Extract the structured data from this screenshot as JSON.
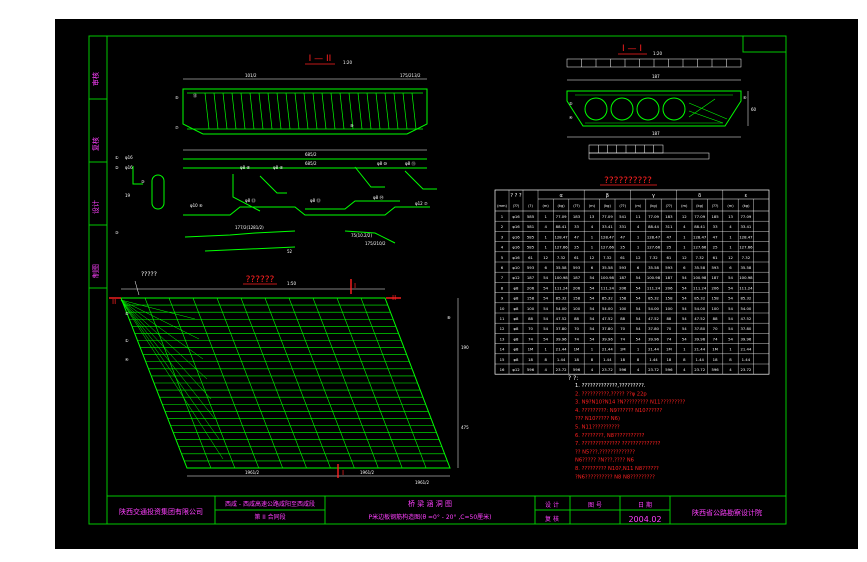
{
  "colors": {
    "background": "#000000",
    "frame": "#00c800",
    "rebar": "#00ff00",
    "dimension": "#ffffff",
    "title_red": "#ff2020",
    "table_line": "#ffffff",
    "table_text": "#ffffff",
    "note_yellow": "#ffff00",
    "label_cyan": "#00ffff",
    "label_magenta": "#ff40ff"
  },
  "side_tabs": [
    "审核",
    "复核",
    "设计",
    "制图"
  ],
  "views": {
    "section_top_title": "I — II",
    "section_top_scale": "1:20",
    "section_right_title": "I — I",
    "section_right_scale": "1:20",
    "table_title": "??????????",
    "plan_title": "??????",
    "plan_note": "?????",
    "plan_scale": "1:50",
    "cut_left": "II",
    "cut_right": "II",
    "cut_bottom": "I",
    "cut_top": "I"
  },
  "table": {
    "groups": [
      "? ? ?",
      "α",
      "β",
      "γ",
      "δ",
      "ε"
    ],
    "header_row2": [
      "(mm)",
      "(??)",
      "(?)",
      "(m)",
      "(kg)",
      "(??)",
      "(m)",
      "(kg)",
      "(??)",
      "(m)",
      "(kg)",
      "(??)",
      "(m)",
      "(kg)",
      "(??)",
      "(m)",
      "(kg)"
    ],
    "rows": [
      [
        "1",
        "φ16",
        "585",
        "1",
        "77.09",
        "183",
        "13",
        "77.09",
        "541",
        "11",
        "77.09",
        "183",
        "12",
        "77.09",
        "185",
        "13",
        "77.09"
      ],
      [
        "2",
        "φ16",
        "581",
        "4",
        "88.41",
        "33",
        "4",
        "33.41",
        "331",
        "4",
        "88.44",
        "311",
        "4",
        "88.41",
        "33",
        "4",
        "33.41"
      ],
      [
        "3",
        "φ16",
        "585",
        "1",
        "128.47",
        "47",
        "1",
        "128.47",
        "47",
        "1",
        "128.47",
        "47",
        "1",
        "128.47",
        "47",
        "1",
        "128.47"
      ],
      [
        "4",
        "φ16",
        "585",
        "1",
        "127.66",
        "25",
        "1",
        "127.66",
        "25",
        "1",
        "127.66",
        "25",
        "1",
        "127.66",
        "25",
        "1",
        "127.66"
      ],
      [
        "5",
        "φ16",
        "61",
        "12",
        "7.32",
        "61",
        "12",
        "7.32",
        "61",
        "12",
        "7.32",
        "61",
        "12",
        "7.32",
        "61",
        "12",
        "7.32"
      ],
      [
        "6",
        "φ10",
        "593",
        "6",
        "35.58",
        "593",
        "6",
        "35.58",
        "593",
        "6",
        "35.58",
        "593",
        "6",
        "35.58",
        "593",
        "6",
        "35.58"
      ],
      [
        "7",
        "φ12",
        "187",
        "54",
        "100.98",
        "187",
        "54",
        "100.98",
        "187",
        "54",
        "100.98",
        "187",
        "54",
        "100.98",
        "187",
        "54",
        "100.98"
      ],
      [
        "8",
        "φ8",
        "206",
        "54",
        "111.24",
        "206",
        "54",
        "111.24",
        "206",
        "54",
        "111.24",
        "206",
        "54",
        "111.24",
        "206",
        "54",
        "111.24"
      ],
      [
        "9",
        "φ8",
        "158",
        "54",
        "85.32",
        "158",
        "54",
        "85.32",
        "158",
        "54",
        "85.32",
        "158",
        "54",
        "85.32",
        "158",
        "54",
        "85.32"
      ],
      [
        "10",
        "φ8",
        "100",
        "54",
        "54.00",
        "100",
        "54",
        "54.00",
        "100",
        "54",
        "54.00",
        "100",
        "54",
        "54.00",
        "100",
        "54",
        "54.00"
      ],
      [
        "11",
        "φ8",
        "88",
        "54",
        "47.52",
        "88",
        "54",
        "47.52",
        "88",
        "54",
        "47.52",
        "88",
        "54",
        "47.52",
        "88",
        "54",
        "47.52"
      ],
      [
        "12",
        "φ8",
        "70",
        "54",
        "37.80",
        "70",
        "54",
        "37.80",
        "70",
        "54",
        "37.80",
        "70",
        "54",
        "37.80",
        "70",
        "54",
        "37.80"
      ],
      [
        "13",
        "φ8",
        "74",
        "54",
        "39.96",
        "74",
        "54",
        "39.96",
        "74",
        "54",
        "39.96",
        "74",
        "54",
        "39.96",
        "74",
        "54",
        "39.96"
      ],
      [
        "14",
        "φ8",
        "1M",
        "1",
        "21.44",
        "1M",
        "1",
        "21.44",
        "1M",
        "1",
        "21.44",
        "1M",
        "1",
        "21.44",
        "1M",
        "1",
        "21.44"
      ],
      [
        "15",
        "φ8",
        "18",
        "8",
        "1.44",
        "18",
        "8",
        "1.44",
        "18",
        "8",
        "1.44",
        "18",
        "8",
        "1.44",
        "18",
        "8",
        "1.44"
      ],
      [
        "16",
        "φ12",
        "596",
        "4",
        "23.72",
        "596",
        "4",
        "23.72",
        "596",
        "4",
        "23.72",
        "596",
        "4",
        "23.72",
        "596",
        "4",
        "23.72"
      ]
    ]
  },
  "notes": {
    "heading": "? ?:",
    "lines": [
      "1. ?????????????,?????????.",
      "2. ??????????,?????  ??φ 22p",
      "3. N9?N10?N14 ?N?????????  N11?????????",
      "4. ?????????:  N9??????    N10??????",
      "   ??? N10????? N6)",
      "5. N11??????????",
      "6. ????????,  N8???????????",
      "7. ?????????????? ??????????????",
      "   ?? N5???,?????????????",
      "   N6????? ?N???,???? N6",
      "8. ?????????  N10?,N11  N8??????",
      "   ?N6??????????  N8 N8?????????"
    ]
  },
  "title_block": {
    "company": "陕西交通投资集团有限公司",
    "project_line1": "西咸 - 西咸高速公路咸阳至西咸段",
    "project_line2": "第 II 合同段",
    "drawing_title": "桥 梁 涵 洞 图",
    "drawing_subtitle": "P米边板钢筋构造图(θ =0° - 20° ,C=50厘米)",
    "design_label": "设 计",
    "review_label": "复 核",
    "no_label": "图 号",
    "date_label": "日 期",
    "date_value": "2004.02",
    "design_institute": "陕西省公路勘察设计院"
  }
}
